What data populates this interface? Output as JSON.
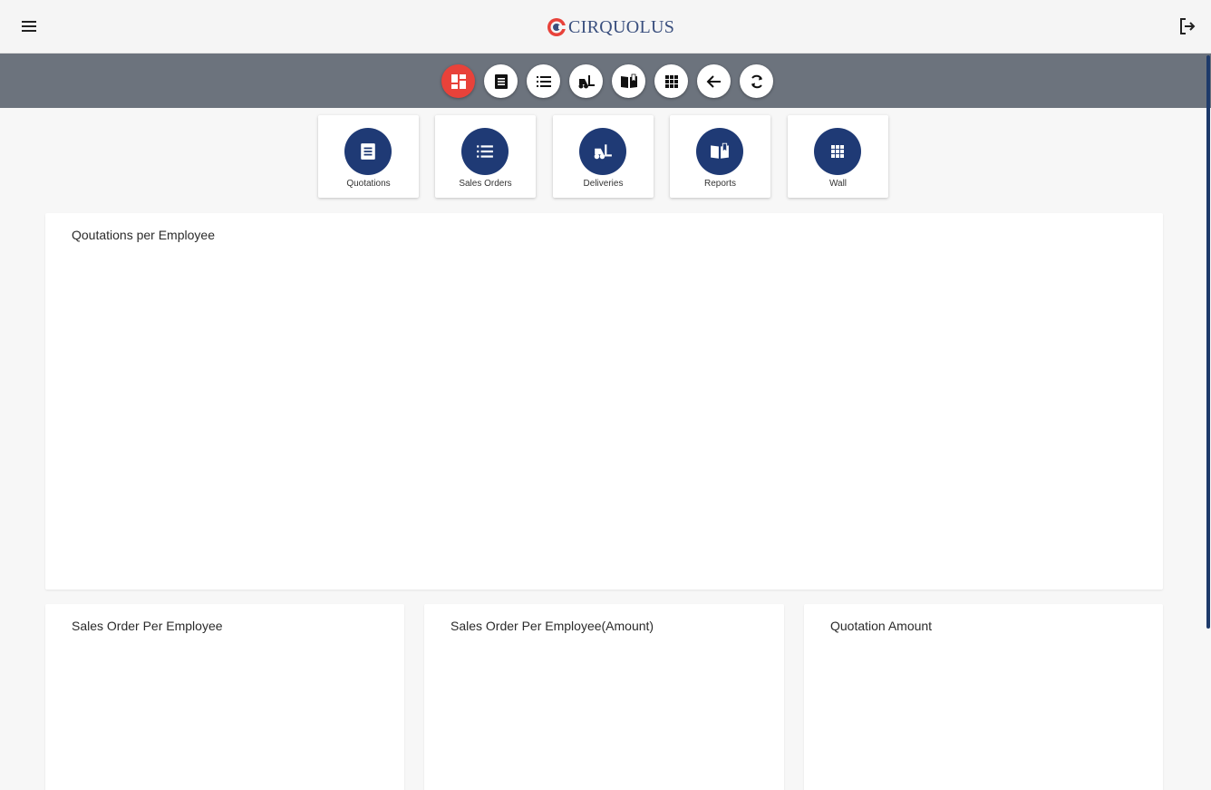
{
  "header": {
    "logo_text": "CIRQUOLUS",
    "menu_icon": "hamburger-menu-icon",
    "logout_icon": "logout-icon"
  },
  "toolbar": {
    "items": [
      {
        "name": "dashboard",
        "icon": "dashboard-icon",
        "active": true
      },
      {
        "name": "quotations",
        "icon": "receipt-icon",
        "active": false
      },
      {
        "name": "sales-orders",
        "icon": "list-icon",
        "active": false
      },
      {
        "name": "deliveries",
        "icon": "forklift-icon",
        "active": false
      },
      {
        "name": "reports",
        "icon": "book-icon",
        "active": false
      },
      {
        "name": "wall",
        "icon": "grid-icon",
        "active": false
      },
      {
        "name": "back",
        "icon": "arrow-left-icon",
        "active": false
      },
      {
        "name": "refresh",
        "icon": "refresh-icon",
        "active": false
      }
    ]
  },
  "shortcuts": [
    {
      "label": "Quotations",
      "icon": "receipt-icon"
    },
    {
      "label": "Sales Orders",
      "icon": "list-icon"
    },
    {
      "label": "Deliveries",
      "icon": "forklift-icon"
    },
    {
      "label": "Reports",
      "icon": "book-icon"
    },
    {
      "label": "Wall",
      "icon": "grid-icon"
    }
  ],
  "cards": {
    "quotations_per_employee": {
      "title": "Qoutations per Employee"
    },
    "sales_order_per_employee": {
      "title": "Sales Order Per Employee"
    },
    "sales_order_per_employee_amount": {
      "title": "Sales Order Per Employee(Amount)"
    },
    "quotation_amount": {
      "title": "Quotation Amount"
    }
  },
  "colors": {
    "accent": "#e8423a",
    "brand": "#1f3a75",
    "toolbar": "#6c737d"
  }
}
